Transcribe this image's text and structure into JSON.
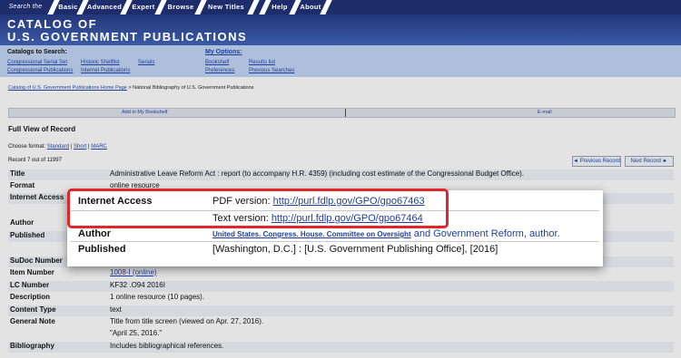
{
  "topnav": {
    "items": [
      "Search the CGP",
      "Basic",
      "Advanced",
      "Expert",
      "Browse",
      "New Titles"
    ],
    "right_items": [
      "Help",
      "About"
    ]
  },
  "banner": {
    "line1": "Catalog of",
    "line2": "U.S. Government Publications"
  },
  "catalogs": {
    "header": "Catalogs to Search:",
    "links": [
      "Congressional Serial Set",
      "Historic Shelflist",
      "Serials",
      "Congressional Publications",
      "Internet Publications"
    ],
    "options_header": "My Options:",
    "options": [
      "Bookshelf",
      "Results list",
      "Preferences",
      "Previous Searches"
    ]
  },
  "breadcrumb": {
    "home": "Catalog of U.S. Government Publications Home Page",
    "current": " > National Bibliography of U.S. Government Publications"
  },
  "actionbar": {
    "add": "Add to My Bookshelf",
    "email": "E-mail"
  },
  "record": {
    "heading": "Full View of Record",
    "format_label": "Choose format:",
    "formats": [
      "Standard",
      "Short",
      "MARC"
    ],
    "count": "Record 7 out of 11997",
    "prev": "◄ Previous Record",
    "next": "Next Record ►"
  },
  "rows": [
    {
      "label": "Title",
      "value": "Administrative Leave Reform Act : report (to accompany H.R. 4359) (including cost estimate of the Congressional Budget Office)."
    },
    {
      "label": "Format",
      "value": "online resource"
    },
    {
      "label": "Internet Access",
      "value": ""
    },
    {
      "label": "Author",
      "value": ""
    },
    {
      "label": "Published",
      "value": ""
    },
    {
      "label": "SuDoc Number",
      "value": ""
    },
    {
      "label": "Item Number",
      "value": "1008-I (online)"
    },
    {
      "label": "LC Number",
      "value": "KF32 .O94 2016I"
    },
    {
      "label": "Description",
      "value": "1 online resource (10 pages)."
    },
    {
      "label": "Content Type",
      "value": "text"
    },
    {
      "label": "General Note",
      "value": "Title from title screen (viewed on Apr. 27, 2016)."
    },
    {
      "label": "",
      "value": "\"April 25, 2016.\""
    },
    {
      "label": "Bibliography",
      "value": "Includes bibliographical references."
    }
  ],
  "callout": {
    "internet_access_label": "Internet Access",
    "pdf_prefix": "PDF version:",
    "pdf_link": "http://purl.fdlp.gov/GPO/gpo67463",
    "text_prefix": "Text version:",
    "text_link": "http://purl.fdlp.gov/GPO/gpo67464",
    "author_label": "Author",
    "author_link": "United States. Congress. House. Committee on Oversight",
    "author_rest": " and Government Reform, author.",
    "published_label": "Published",
    "published_value": "[Washington, D.C.] : [U.S. Government Publishing Office], [2016]"
  },
  "colors": {
    "nav": "#1d2d6b",
    "banner": "#3a5aa7",
    "highlight": "#e0262b",
    "link": "#1f3f9a"
  }
}
